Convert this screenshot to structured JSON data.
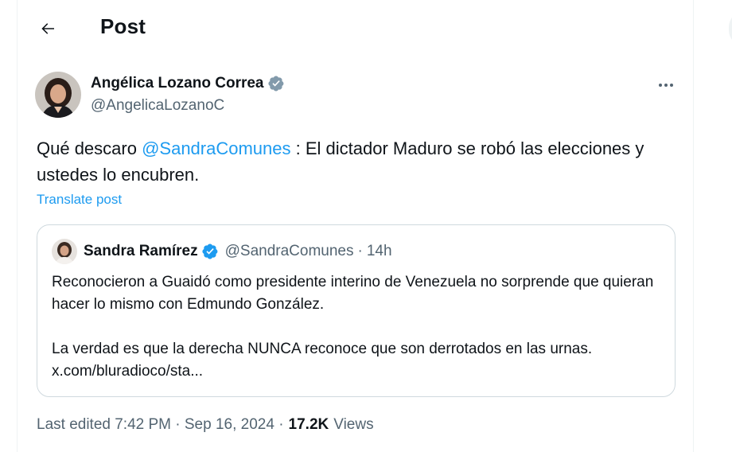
{
  "header": {
    "title": "Post"
  },
  "post": {
    "author_name": "Angélica Lozano Correa",
    "author_handle": "@AngelicaLozanoC",
    "text_before": "Qué descaro ",
    "mention": "@SandraComunes",
    "text_after": " : El dictador Maduro se robó las elecciones y ustedes lo encubren.",
    "translate_label": "Translate post"
  },
  "quote": {
    "author_name": "Sandra Ramírez",
    "author_handle": "@SandraComunes",
    "separator": "·",
    "time": "14h",
    "paragraph1": "Reconocieron a Guaidó como presidente interino de Venezuela no sorprende que quieran hacer lo mismo con Edmundo González.",
    "paragraph2": "La verdad es que la derecha NUNCA reconoce que son derrotados en las urnas. x.com/bluradioco/sta..."
  },
  "meta": {
    "edited": "Last edited 7:42 PM · Sep 16, 2024 ·",
    "views_count": "17.2K",
    "views_label": "Views"
  },
  "colors": {
    "accent": "#1d9bf0",
    "verified_badge": "#829aab",
    "verified_badge_quote": "#1d9bf0",
    "secondary_text": "#536471",
    "border": "#cfd9de"
  },
  "icons": {
    "back": "arrow-left-icon",
    "verified": "verified-badge-icon",
    "more": "more-horizontal-icon"
  }
}
